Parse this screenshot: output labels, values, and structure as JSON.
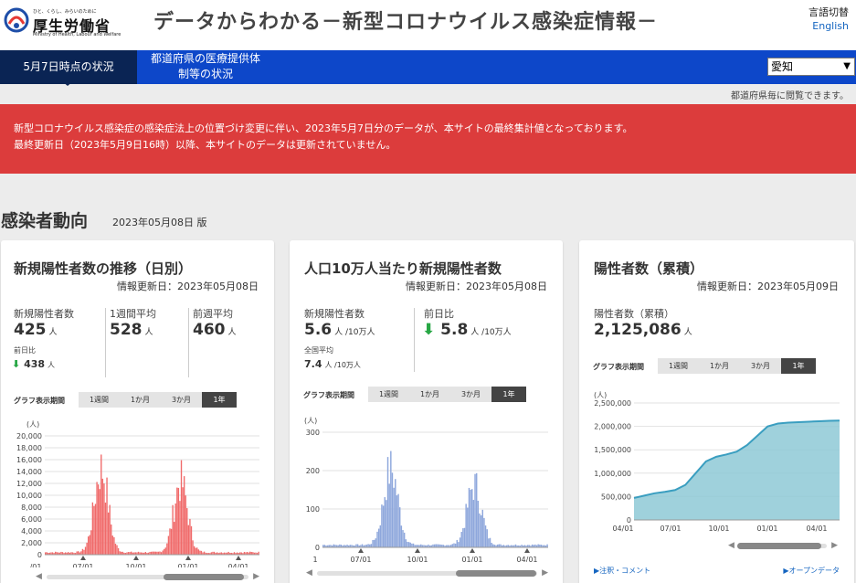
{
  "header": {
    "logo_tagline": "ひと、くらし、みらいのために",
    "logo_text": "厚生労働省",
    "logo_english": "Ministry of Health, Labour and Welfare",
    "title": "データからわかる－新型コロナウイルス感染症情報－",
    "lang_label": "言語切替",
    "lang_link": "English"
  },
  "nav": {
    "active_tab": "5月7日時点の状況",
    "tab2_line1": "都道府県の医療提供体",
    "tab2_line2": "制等の状況",
    "prefecture": "愛知",
    "note": "都道府県毎に閲覧できます。"
  },
  "alert": {
    "line1": "新型コロナウイルス感染症の感染症法上の位置づけ変更に伴い、2023年5月7日分のデータが、本サイトの最終集計値となっております。",
    "line2": "最終更新日（2023年5月9日16時）以降、本サイトのデータは更新されていません。"
  },
  "section": {
    "title": "感染者動向",
    "date": "2023年05月08日 版"
  },
  "period_label": "グラフ表示期間",
  "periods": [
    "1週間",
    "1か月",
    "3か月",
    "1年"
  ],
  "colors": {
    "chart1": "#f06a6a",
    "chart2": "#8ea7dc",
    "chart3": "#8ec9d6",
    "chart3_line": "#3a9ec0",
    "down_arrow": "#28a745"
  },
  "card1": {
    "title": "新規陽性者数の推移（日別）",
    "updated": "情報更新日：2023年05月08日",
    "m1_label": "新規陽性者数",
    "m1_value": "425",
    "m1_unit": "人",
    "m2_label": "1週間平均",
    "m2_value": "528",
    "m2_unit": "人",
    "m3_label": "前週平均",
    "m3_value": "460",
    "m3_unit": "人",
    "dod_label": "前日比",
    "dod_value": "438",
    "dod_unit": "人"
  },
  "card2": {
    "title": "人口10万人当たり新規陽性者数",
    "updated": "情報更新日：2023年05月08日",
    "m1_label": "新規陽性者数",
    "m1_value": "5.6",
    "m1_unit": "人 /10万人",
    "nat_label": "全国平均",
    "nat_value": "7.4",
    "nat_unit": "人 /10万人",
    "dod_label": "前日比",
    "dod_value": "5.8",
    "dod_unit": "人 /10万人"
  },
  "card3": {
    "title": "陽性者数（累積）",
    "updated": "情報更新日：2023年05月09日",
    "m1_label": "陽性者数（累積）",
    "m1_value": "2,125,086",
    "m1_unit": "人",
    "link_notes": "▶注釈・コメント",
    "link_open": "▶オープンデータ"
  },
  "chart_data": [
    {
      "type": "bar",
      "unit_label": "(人)",
      "ylim": [
        0,
        20000
      ],
      "yticks": [
        "0",
        "2,000",
        "4,000",
        "6,000",
        "8,000",
        "10,000",
        "12,000",
        "14,000",
        "16,000",
        "18,000",
        "20,000"
      ],
      "xticks": [
        "/01",
        "07/01",
        "10/01",
        "01/01",
        "04/01"
      ],
      "peaks": [
        {
          "position": 0.26,
          "value": 17500
        },
        {
          "position": 0.63,
          "value": 14800
        }
      ],
      "baseline": 500
    },
    {
      "type": "bar",
      "unit_label": "(人)",
      "ylim": [
        0,
        300
      ],
      "yticks": [
        "0",
        "100",
        "200",
        "300"
      ],
      "xticks": [
        "1",
        "07/01",
        "10/01",
        "01/01",
        "04/01"
      ],
      "peaks": [
        {
          "position": 0.3,
          "value": 245
        },
        {
          "position": 0.67,
          "value": 195
        }
      ],
      "baseline": 8
    },
    {
      "type": "area",
      "unit_label": "(人)",
      "ylim": [
        0,
        2500000
      ],
      "yticks": [
        "0",
        "500,000",
        "1,000,000",
        "1,500,000",
        "2,000,000",
        "2,500,000"
      ],
      "xticks": [
        "04/01",
        "07/01",
        "10/01",
        "01/01",
        "04/01"
      ],
      "values": [
        470000,
        520000,
        570000,
        600000,
        640000,
        750000,
        1000000,
        1250000,
        1350000,
        1400000,
        1460000,
        1600000,
        1800000,
        2000000,
        2060000,
        2080000,
        2090000,
        2100000,
        2110000,
        2120000,
        2125086
      ]
    }
  ]
}
